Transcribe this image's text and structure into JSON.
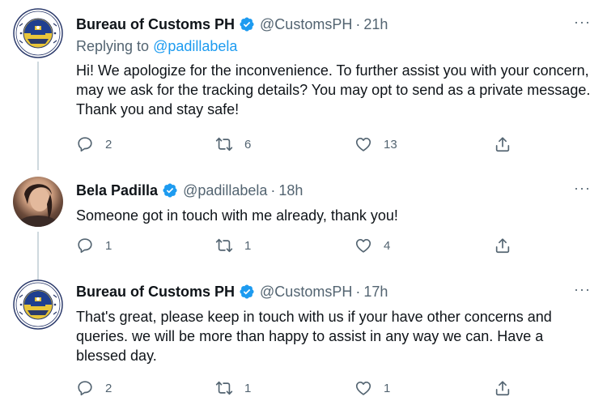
{
  "tweets": [
    {
      "name": "Bureau of Customs PH",
      "handle": "@CustomsPH",
      "separator": "·",
      "time": "21h",
      "reply_prefix": "Replying to",
      "reply_handle": "@padillabela",
      "text": "Hi! We apologize for the inconvenience. To further assist you with your concern, may we ask for the tracking details? You may opt to send as a private message. Thank you and stay safe!",
      "replies": "2",
      "retweets": "6",
      "likes": "13",
      "more": "···"
    },
    {
      "name": "Bela Padilla",
      "handle": "@padillabela",
      "separator": "·",
      "time": "18h",
      "text": "Someone got in touch with me already, thank you!",
      "replies": "1",
      "retweets": "1",
      "likes": "4",
      "more": "···"
    },
    {
      "name": "Bureau of Customs PH",
      "handle": "@CustomsPH",
      "separator": "·",
      "time": "17h",
      "text": "That's great, please keep in touch with us if your have other concerns and queries. we will be more than happy to assist in any way we can. Have a blessed day.",
      "replies": "2",
      "retweets": "1",
      "likes": "1",
      "more": "···"
    }
  ],
  "colors": {
    "verified": "#1d9bf0",
    "secondary_text": "#536471",
    "link": "#1d9bf0",
    "thread_line": "#cfd9de"
  },
  "icons": [
    "reply-icon",
    "retweet-icon",
    "like-icon",
    "share-icon",
    "verified-badge-icon",
    "more-icon"
  ]
}
